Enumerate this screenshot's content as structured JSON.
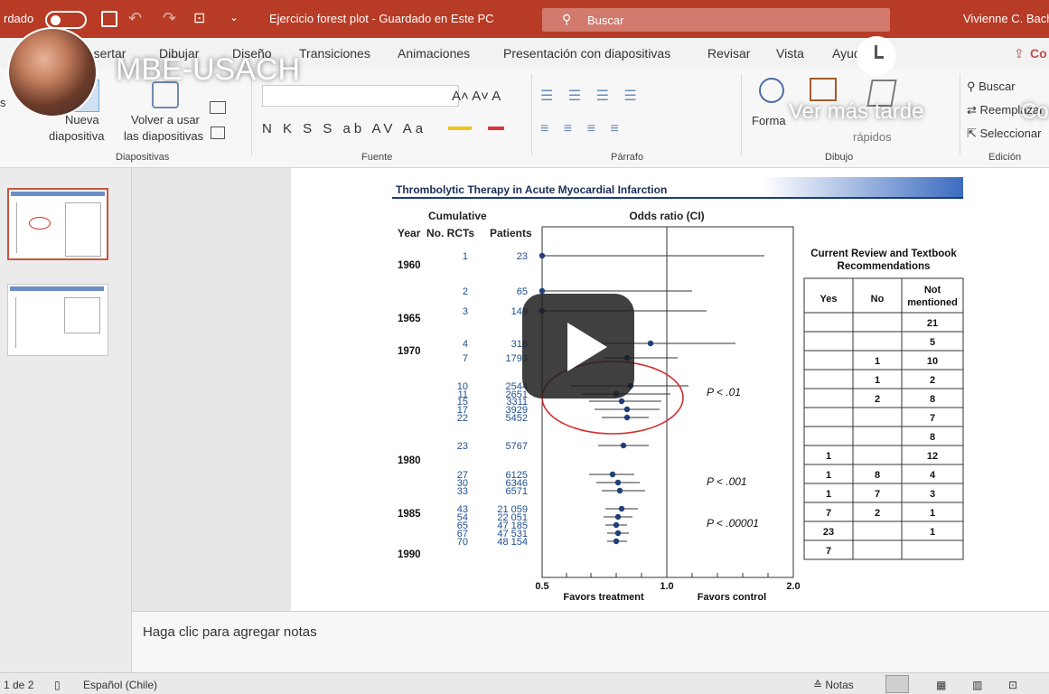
{
  "titlebar": {
    "autosave_label": "rdado",
    "doc_title": "Ejercicio forest plot - Guardado en Este PC",
    "search_placeholder": "Buscar",
    "user_name": "Vivienne C. Bach"
  },
  "overlay": {
    "channel_title": "MBE-USACH",
    "watch_later": "Ver más tarde",
    "share_partial": "Co"
  },
  "ribbon_tabs": [
    "Insertar",
    "Dibujar",
    "Diseño",
    "Transiciones",
    "Animaciones",
    "Presentación con diapositivas",
    "Revisar",
    "Vista",
    "Ayuda"
  ],
  "ribbon": {
    "nueva": "Nueva",
    "diapositiva": "diapositiva",
    "volver": "Volver a usar",
    "las_diapositivas": "las diapositivas",
    "group_diapositivas": "Diapositivas",
    "group_fuente": "Fuente",
    "group_parrafo": "Párrafo",
    "group_dibujo": "Dibujo",
    "group_edicion": "Edición",
    "forma": "Forma",
    "rapidos": "rápidos",
    "buscar": "Buscar",
    "reemplazar": "Reemplazar",
    "seleccionar": "Seleccionar",
    "font_row": "N K S S ab AV Aa",
    "left_group": "s"
  },
  "notes_placeholder": "Haga clic para agregar notas",
  "status": {
    "slide_count": "1 de 2",
    "language": "Español (Chile)",
    "notes": "Notas"
  },
  "slide": {
    "header_title": "Thrombolytic Therapy in Acute Myocardial Infarction",
    "col_cumulative": "Cumulative",
    "col_year": "Year",
    "col_rcts": "No. RCTs",
    "col_patients": "Patients",
    "col_or": "Odds ratio (CI)",
    "years": [
      "1960",
      "1965",
      "1970",
      "1980",
      "1985",
      "1990"
    ],
    "rows": [
      {
        "rcts": "1",
        "patients": "23"
      },
      {
        "rcts": "2",
        "patients": "65"
      },
      {
        "rcts": "3",
        "patients": "149"
      },
      {
        "rcts": "4",
        "patients": "316"
      },
      {
        "rcts": "7",
        "patients": "1793"
      },
      {
        "rcts": "10",
        "patients": "2544"
      },
      {
        "rcts": "11",
        "patients": "2651"
      },
      {
        "rcts": "15",
        "patients": "3311"
      },
      {
        "rcts": "17",
        "patients": "3929"
      },
      {
        "rcts": "22",
        "patients": "5452"
      },
      {
        "rcts": "23",
        "patients": "5767"
      },
      {
        "rcts": "27",
        "patients": "6125"
      },
      {
        "rcts": "30",
        "patients": "6346"
      },
      {
        "rcts": "33",
        "patients": "6571"
      },
      {
        "rcts": "43",
        "patients": "21 059"
      },
      {
        "rcts": "54",
        "patients": "22 051"
      },
      {
        "rcts": "65",
        "patients": "47 185"
      },
      {
        "rcts": "67",
        "patients": "47 531"
      },
      {
        "rcts": "70",
        "patients": "48 154"
      }
    ],
    "p1": "P < .01",
    "p2": "P < .001",
    "p3": "P < .00001",
    "axis_ticks": [
      "0.5",
      "1.0",
      "2.0"
    ],
    "favors_treatment": "Favors treatment",
    "favors_control": "Favors control",
    "review_title_1": "Current Review and Textbook",
    "review_title_2": "Recommendations",
    "table_headers": [
      "Yes",
      "No",
      "Not mentioned"
    ],
    "table_rows": [
      [
        "",
        "",
        "21"
      ],
      [
        "",
        "",
        "5"
      ],
      [
        "",
        "1",
        "10"
      ],
      [
        "",
        "1",
        "2"
      ],
      [
        "",
        "2",
        "8"
      ],
      [
        "",
        "",
        "7"
      ],
      [
        "",
        "",
        "8"
      ],
      [
        "1",
        "",
        "12"
      ],
      [
        "1",
        "8",
        "4"
      ],
      [
        "1",
        "7",
        "3"
      ],
      [
        "7",
        "2",
        "1"
      ],
      [
        "23",
        "",
        "1"
      ],
      [
        "7",
        "",
        ""
      ]
    ]
  },
  "colors": {
    "titlebar": "#b83b26",
    "forest_blue": "#1f4e8c",
    "highlight_red": "#d03030"
  }
}
